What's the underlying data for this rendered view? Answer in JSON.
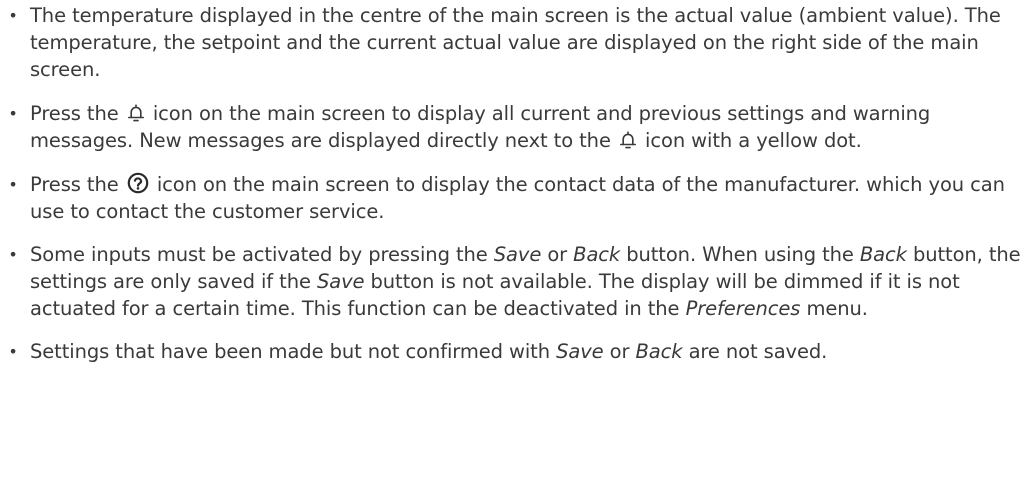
{
  "bullet_symbol": "•",
  "icons": {
    "bell": "bell-icon",
    "help": "question-circle-icon"
  },
  "bullets": {
    "b1": {
      "text": "The temperature displayed in the centre of the main screen is the actual value (ambient value). The temperature, the setpoint and the current actual value are displayed on the right side of the main screen."
    },
    "b2": {
      "t1": "Press the ",
      "t2": " icon on the main screen to display all current and previous settings and warning messages. New messages are displayed directly next to the ",
      "t3": " icon with a yellow dot."
    },
    "b3": {
      "t1": "Press the ",
      "t2": " icon on the main screen to display the contact data of the manufacturer. which you can use to contact the customer service."
    },
    "b4": {
      "t1": "Some inputs must be activated by pressing the ",
      "save": "Save",
      "t2": " or ",
      "back": "Back",
      "t3": " button. When using the ",
      "back2": "Back",
      "t4": " button, the settings are only saved if the ",
      "save2": "Save",
      "t5": " button is not available. The display will be dimmed if it is not actuated for a certain time. This function can be deactivated in the ",
      "preferences": "Preferences",
      "t6": " menu."
    },
    "b5": {
      "t1": "Settings that have been made but not confirmed with ",
      "save": "Save",
      "t2": " or ",
      "back": "Back",
      "t3": " are not saved."
    }
  }
}
